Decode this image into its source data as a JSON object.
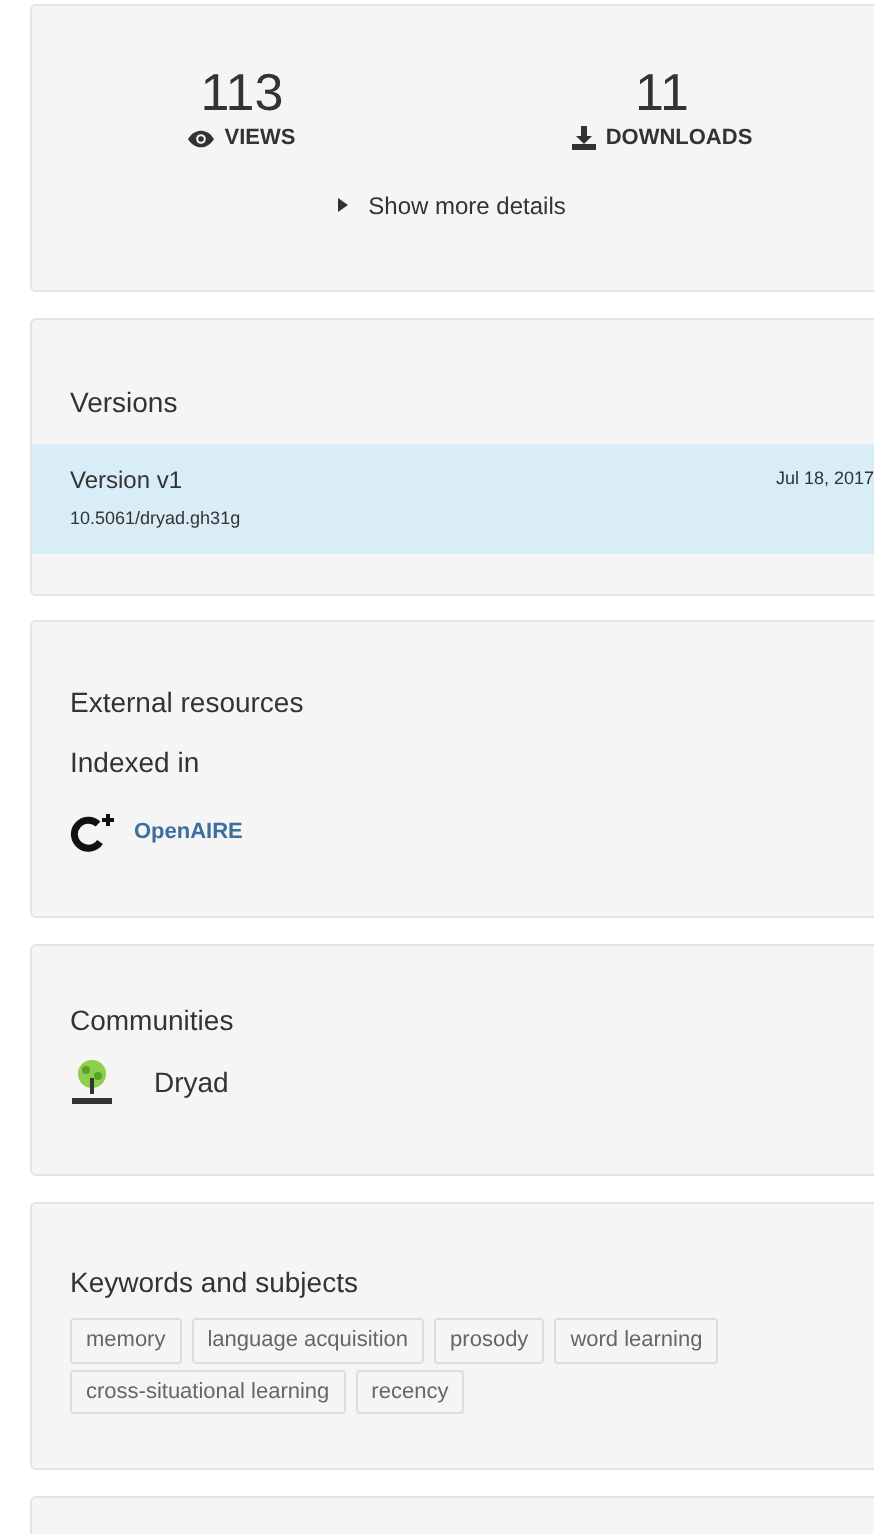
{
  "stats": [
    {
      "kind": "views",
      "value": "113",
      "label": "VIEWS"
    },
    {
      "kind": "downloads",
      "value": "11",
      "label": "DOWNLOADS"
    }
  ],
  "details_toggle": {
    "label": "Show more details",
    "expanded": false
  },
  "versions": {
    "title": "Versions",
    "items": [
      {
        "name": "Version v1",
        "doi": "10.5061/dryad.gh31g",
        "date": "Jul 18, 2017",
        "selected": true
      }
    ]
  },
  "external_resources": {
    "title": "External resources",
    "subtitle": "Indexed in",
    "links": [
      "OpenAIRE"
    ]
  },
  "communities": {
    "title": "Communities",
    "items": [
      "Dryad"
    ]
  },
  "keywords": {
    "title": "Keywords and subjects",
    "tags": [
      "memory",
      "language acquisition",
      "prosody",
      "word learning",
      "cross-situational learning",
      "recency"
    ]
  }
}
